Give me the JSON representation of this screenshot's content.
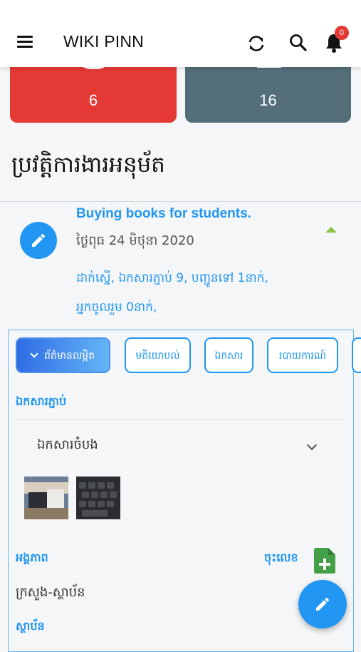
{
  "app": {
    "title": "WIKI PINN",
    "notification_count": "0"
  },
  "stats": [
    {
      "value": "6",
      "color": "#e53935"
    },
    {
      "value": "16",
      "color": "#546e7a"
    }
  ],
  "section": {
    "title": "ប្រវត្តិការងារអនុម័ត"
  },
  "history_item": {
    "title": "Buying books for students.",
    "date": "ថ្ងៃពុធ 24 មិថុនា 2020",
    "meta_line1": "ដាក់ស្នើ, ឯកសារភ្ជាប់ 9, បញ្ជូនទៅ 1នាក់,",
    "meta_line2": "អ្នកចូលរួម 0នាក់,"
  },
  "tabs": [
    {
      "label": "ព័ត៌មានលម្អិត",
      "active": true
    },
    {
      "label": "មតិយោបល់"
    },
    {
      "label": "ឯកសារ"
    },
    {
      "label": "របាយការណ៍"
    }
  ],
  "details": {
    "attachments_label": "ឯកសារភ្ជាប់",
    "dropdown_value": "ឯកសារចំបង",
    "entity_label": "អង្គភាព",
    "register_label": "ចុះលេខ",
    "entity_value": "ក្រសួង-ស្ថាប័ន",
    "institution_label": "ស្ថាប័ន"
  },
  "colors": {
    "accent": "#2196f3",
    "danger": "#e53935",
    "slate": "#546e7a",
    "green": "#43a047"
  }
}
